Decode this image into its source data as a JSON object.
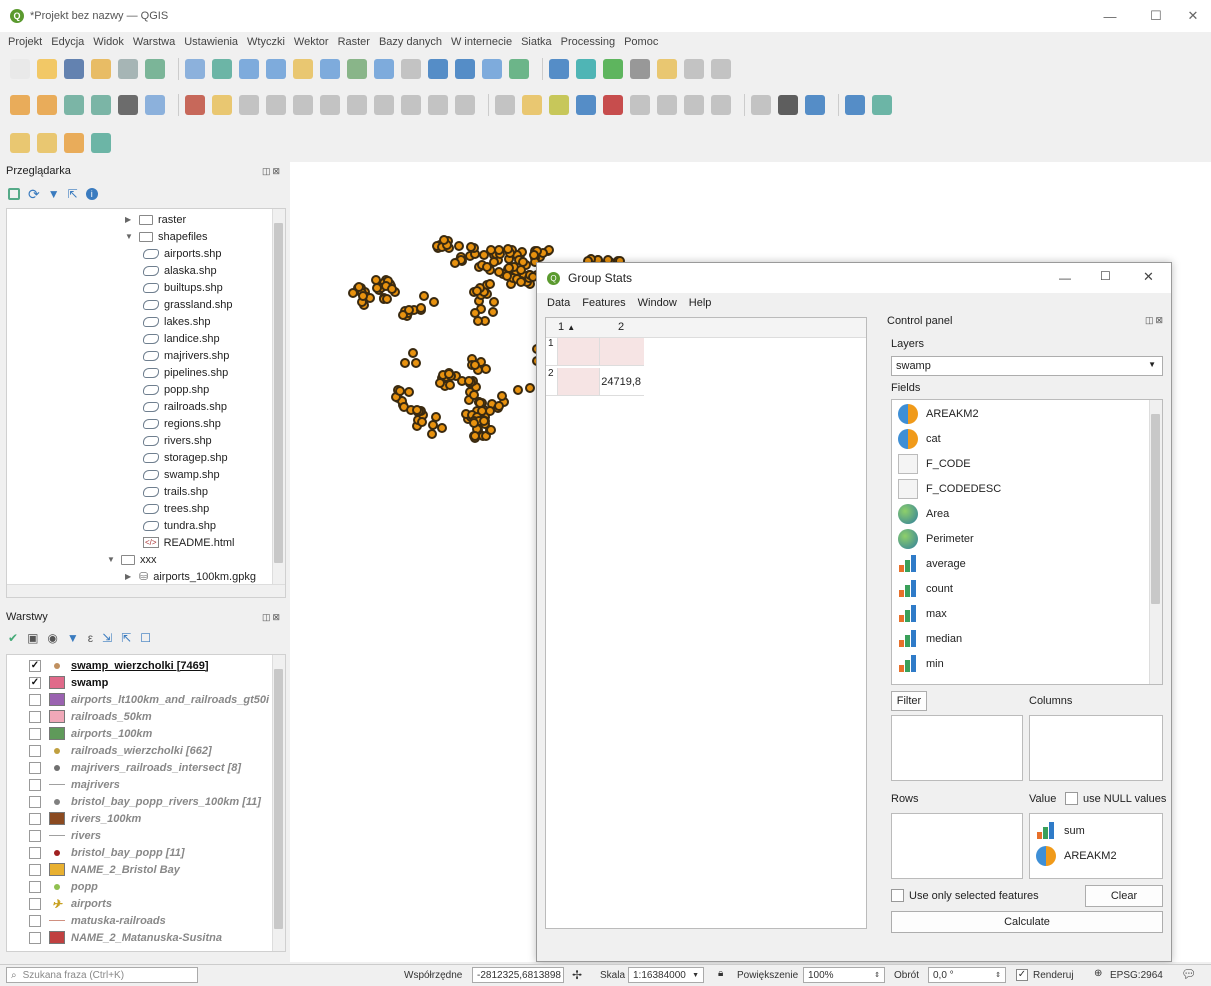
{
  "window": {
    "title": "*Projekt bez nazwy — QGIS"
  },
  "menubar": [
    "Projekt",
    "Edycja",
    "Widok",
    "Warstwa",
    "Ustawienia",
    "Wtyczki",
    "Wektor",
    "Raster",
    "Bazy danych",
    "W internecie",
    "Siatka",
    "Processing",
    "Pomoc"
  ],
  "browser": {
    "title": "Przeglądarka",
    "items": [
      {
        "label": "raster",
        "type": "folder",
        "indent": 1
      },
      {
        "label": "shapefiles",
        "type": "folder-open",
        "indent": 1
      },
      {
        "label": "airports.shp",
        "type": "shp",
        "indent": 2
      },
      {
        "label": "alaska.shp",
        "type": "shp",
        "indent": 2
      },
      {
        "label": "builtups.shp",
        "type": "shp",
        "indent": 2
      },
      {
        "label": "grassland.shp",
        "type": "shp",
        "indent": 2
      },
      {
        "label": "lakes.shp",
        "type": "shp",
        "indent": 2
      },
      {
        "label": "landice.shp",
        "type": "shp",
        "indent": 2
      },
      {
        "label": "majrivers.shp",
        "type": "shp",
        "indent": 2
      },
      {
        "label": "pipelines.shp",
        "type": "shp",
        "indent": 2
      },
      {
        "label": "popp.shp",
        "type": "shp",
        "indent": 2
      },
      {
        "label": "railroads.shp",
        "type": "shp",
        "indent": 2
      },
      {
        "label": "regions.shp",
        "type": "shp",
        "indent": 2
      },
      {
        "label": "rivers.shp",
        "type": "shp",
        "indent": 2
      },
      {
        "label": "storagep.shp",
        "type": "shp",
        "indent": 2
      },
      {
        "label": "swamp.shp",
        "type": "shp",
        "indent": 2
      },
      {
        "label": "trails.shp",
        "type": "shp",
        "indent": 2
      },
      {
        "label": "trees.shp",
        "type": "shp",
        "indent": 2
      },
      {
        "label": "tundra.shp",
        "type": "shp",
        "indent": 2
      },
      {
        "label": "README.html",
        "type": "html",
        "indent": 2
      },
      {
        "label": "xxx",
        "type": "folder-open",
        "indent": 0
      },
      {
        "label": "airports_100km.gpkg",
        "type": "gpkg",
        "indent": 1
      }
    ]
  },
  "layers": {
    "title": "Warstwy",
    "items": [
      {
        "label": "swamp_wierzcholki [7469]",
        "checked": true,
        "sym": "dot",
        "color": "#c09060",
        "underline": true
      },
      {
        "label": "swamp",
        "checked": true,
        "sym": "fill",
        "color": "#e06a8a"
      },
      {
        "label": "airports_lt100km_and_railroads_gt50i",
        "checked": false,
        "sym": "fill",
        "color": "#9a62b0"
      },
      {
        "label": "railroads_50km",
        "checked": false,
        "sym": "fill",
        "color": "#f0a8b8"
      },
      {
        "label": "airports_100km",
        "checked": false,
        "sym": "fill",
        "color": "#5f9a5a"
      },
      {
        "label": "railroads_wierzcholki [662]",
        "checked": false,
        "sym": "dot",
        "color": "#c0a040"
      },
      {
        "label": "majrivers_railroads_intersect [8]",
        "checked": false,
        "sym": "dot",
        "color": "#707070"
      },
      {
        "label": "majrivers",
        "checked": false,
        "sym": "line",
        "color": "#a0a0a0"
      },
      {
        "label": "bristol_bay_popp_rivers_100km [11]",
        "checked": false,
        "sym": "dot",
        "color": "#808080"
      },
      {
        "label": "rivers_100km",
        "checked": false,
        "sym": "fill",
        "color": "#8b4a20"
      },
      {
        "label": "rivers",
        "checked": false,
        "sym": "line",
        "color": "#a0a0a0"
      },
      {
        "label": "bristol_bay_popp [11]",
        "checked": false,
        "sym": "dot",
        "color": "#a02020"
      },
      {
        "label": "NAME_2_Bristol Bay",
        "checked": false,
        "sym": "fill",
        "color": "#e8b030"
      },
      {
        "label": "popp",
        "checked": false,
        "sym": "dot",
        "color": "#90c050"
      },
      {
        "label": "airports",
        "checked": false,
        "sym": "plane",
        "color": "#c8a020"
      },
      {
        "label": "matuska-railroads",
        "checked": false,
        "sym": "line",
        "color": "#d09080"
      },
      {
        "label": "NAME_2_Matanuska-Susitna",
        "checked": false,
        "sym": "fill",
        "color": "#c04040"
      }
    ]
  },
  "status": {
    "search_placeholder": "Szukana fraza (Ctrl+K)",
    "coord_label": "Współrzędne",
    "coord_value": "-2812325,6813898",
    "scale_label": "Skala",
    "scale_value": "1:16384000",
    "magnifier_label": "Powiększenie",
    "magnifier_value": "100%",
    "rotation_label": "Obrót",
    "rotation_value": "0,0 °",
    "render_label": "Renderuj",
    "crs": "EPSG:2964"
  },
  "groupstats": {
    "title": "Group Stats",
    "menu": [
      "Data",
      "Features",
      "Window",
      "Help"
    ],
    "table": {
      "col_headers": [
        "1",
        "2"
      ],
      "row_headers": [
        "1",
        "2"
      ],
      "cells": [
        [
          "",
          ""
        ],
        [
          "",
          "24719,8"
        ]
      ]
    },
    "control_panel_title": "Control panel",
    "layers_label": "Layers",
    "layer_selected": "swamp",
    "fields_label": "Fields",
    "fields": [
      {
        "name": "AREAKM2",
        "icon": "pie"
      },
      {
        "name": "cat",
        "icon": "pie"
      },
      {
        "name": "F_CODE",
        "icon": "text"
      },
      {
        "name": "F_CODEDESC",
        "icon": "text"
      },
      {
        "name": "Area",
        "icon": "globe"
      },
      {
        "name": "Perimeter",
        "icon": "globe"
      },
      {
        "name": "average",
        "icon": "bars"
      },
      {
        "name": "count",
        "icon": "bars"
      },
      {
        "name": "max",
        "icon": "bars"
      },
      {
        "name": "median",
        "icon": "bars"
      },
      {
        "name": "min",
        "icon": "bars"
      }
    ],
    "filter_label": "Filter",
    "columns_label": "Columns",
    "rows_label": "Rows",
    "value_label": "Value",
    "use_null_label": "use NULL values",
    "value_items": [
      {
        "name": "sum",
        "icon": "bars"
      },
      {
        "name": "AREAKM2",
        "icon": "pie"
      }
    ],
    "use_selected_label": "Use only selected features",
    "clear_label": "Clear",
    "calculate_label": "Calculate"
  }
}
